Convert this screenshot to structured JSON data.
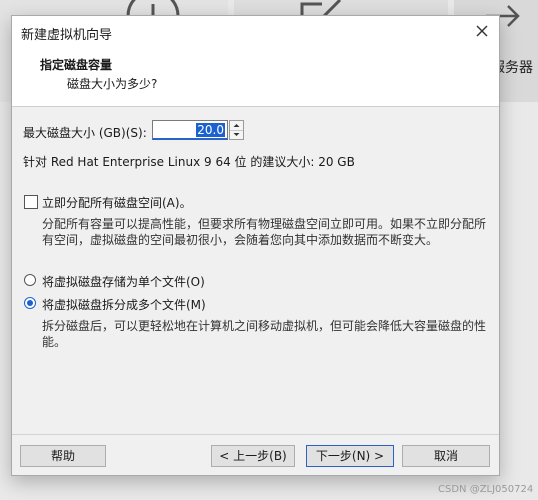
{
  "background": {
    "tile_label": "程服务器",
    "icons": [
      "home-icon",
      "edit-icon",
      "connect-icon"
    ]
  },
  "dialog": {
    "title": "新建虚拟机向导",
    "header_title": "指定磁盘容量",
    "header_subtitle": "磁盘大小为多少?",
    "max_size_label": "最大磁盘大小 (GB)(S):",
    "max_size_value": "20.0",
    "recommendation": "针对 Red Hat Enterprise Linux 9 64 位 的建议大小: 20 GB",
    "allocate_checkbox": {
      "label": "立即分配所有磁盘空间(A)。",
      "checked": false,
      "description": "分配所有容量可以提高性能，但要求所有物理磁盘空间立即可用。如果不立即分配所有空间，虚拟磁盘的空间最初很小，会随着您向其中添加数据而不断变大。"
    },
    "storage_options": [
      {
        "label": "将虚拟磁盘存储为单个文件(O)",
        "selected": false
      },
      {
        "label": "将虚拟磁盘拆分成多个文件(M)",
        "selected": true
      }
    ],
    "split_description": "拆分磁盘后，可以更轻松地在计算机之间移动虚拟机，但可能会降低大容量磁盘的性能。",
    "buttons": {
      "help": "帮助",
      "back": "< 上一步(B)",
      "next": "下一步(N) >",
      "cancel": "取消"
    }
  },
  "watermark": "CSDN @ZLJ050724",
  "colors": {
    "accent": "#1b62cf",
    "dialog_bg": "#f0f0f0"
  }
}
